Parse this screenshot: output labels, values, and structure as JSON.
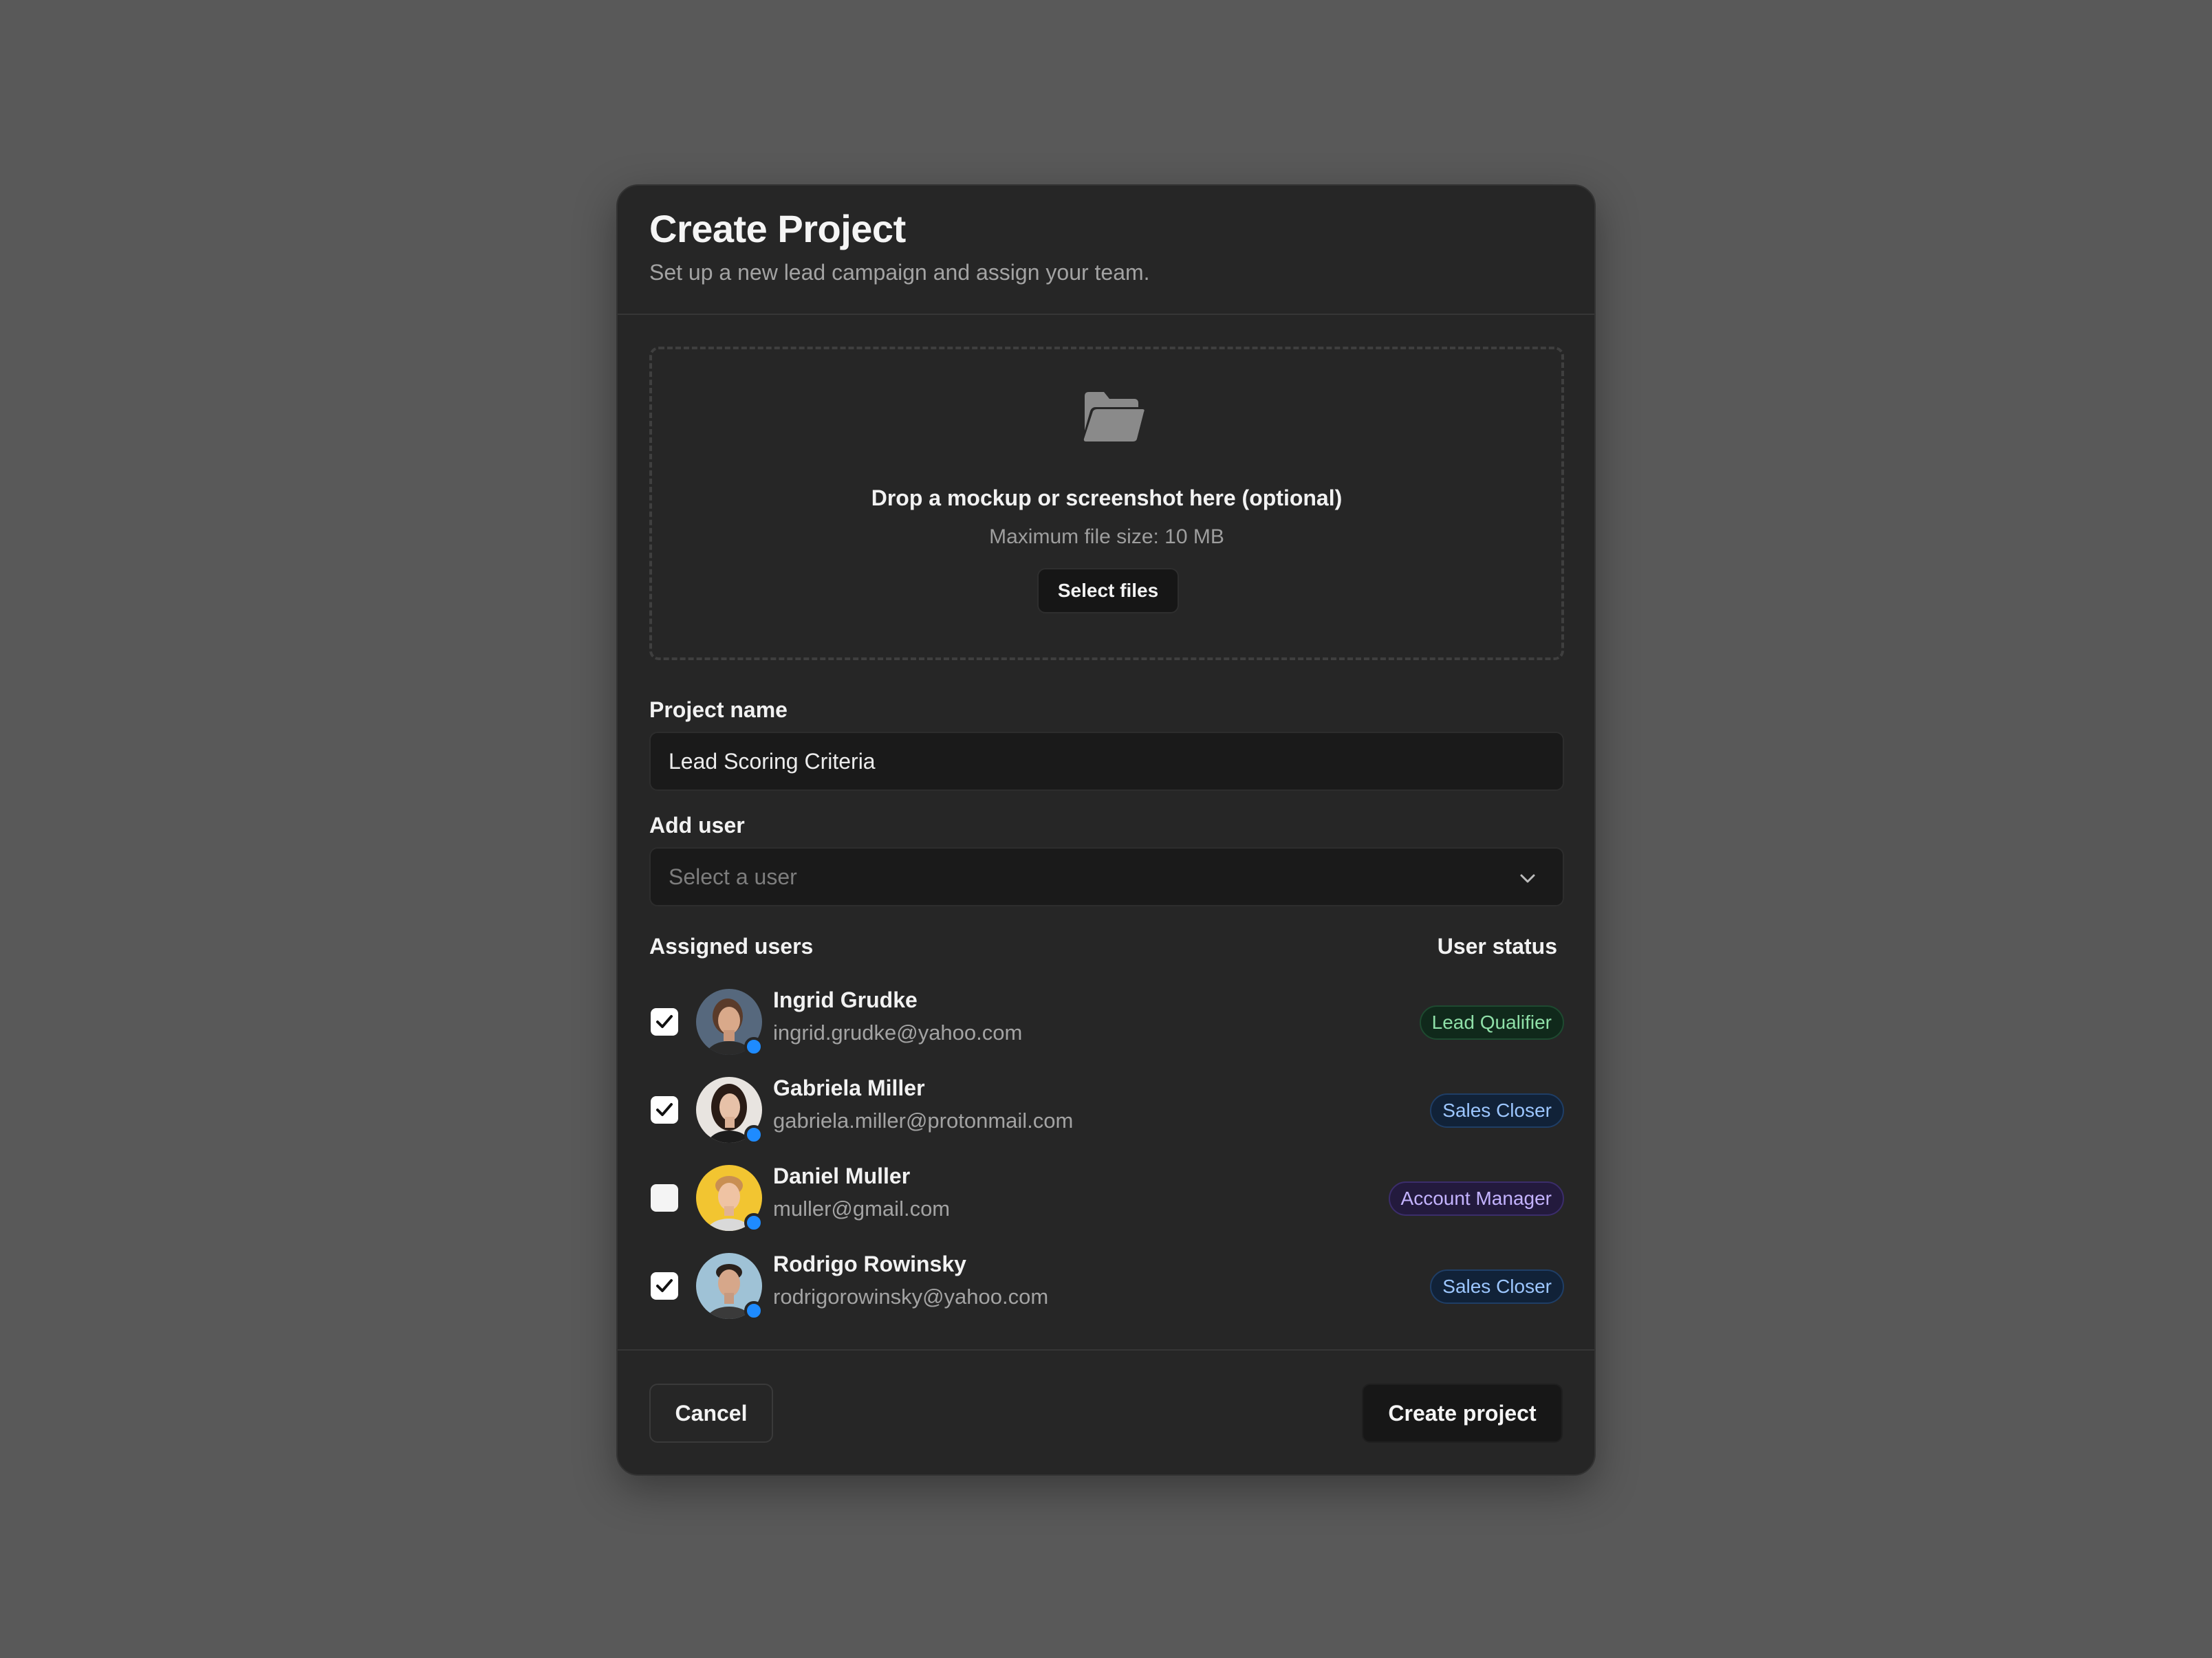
{
  "modal": {
    "title": "Create Project",
    "subtitle": "Set up a new lead campaign and assign your team."
  },
  "dropzone": {
    "icon": "folder-open-icon",
    "title": "Drop a mockup or screenshot here (optional)",
    "subtitle": "Maximum file size: 10 MB",
    "button_label": "Select files"
  },
  "project_name": {
    "label": "Project name",
    "value": "Lead Scoring Criteria"
  },
  "add_user": {
    "label": "Add user",
    "placeholder": "Select a user",
    "icon": "chevron-down-icon"
  },
  "assigned": {
    "heading": "Assigned users",
    "status_heading": "User status",
    "users": [
      {
        "name": "Ingrid Grudke",
        "email": "ingrid.grudke@yahoo.com",
        "checked": true,
        "role": "Lead Qualifier",
        "role_color": "green"
      },
      {
        "name": "Gabriela Miller",
        "email": "gabriela.miller@protonmail.com",
        "checked": true,
        "role": "Sales Closer",
        "role_color": "blue"
      },
      {
        "name": "Daniel Muller",
        "email": "muller@gmail.com",
        "checked": false,
        "role": "Account Manager",
        "role_color": "purple"
      },
      {
        "name": "Rodrigo Rowinsky",
        "email": "rodrigorowinsky@yahoo.com",
        "checked": true,
        "role": "Sales Closer",
        "role_color": "blue"
      }
    ]
  },
  "footer": {
    "cancel_label": "Cancel",
    "create_label": "Create project"
  },
  "colors": {
    "backdrop": "#595959",
    "modal_bg": "#262626",
    "status_dot": "#1e8bff"
  }
}
